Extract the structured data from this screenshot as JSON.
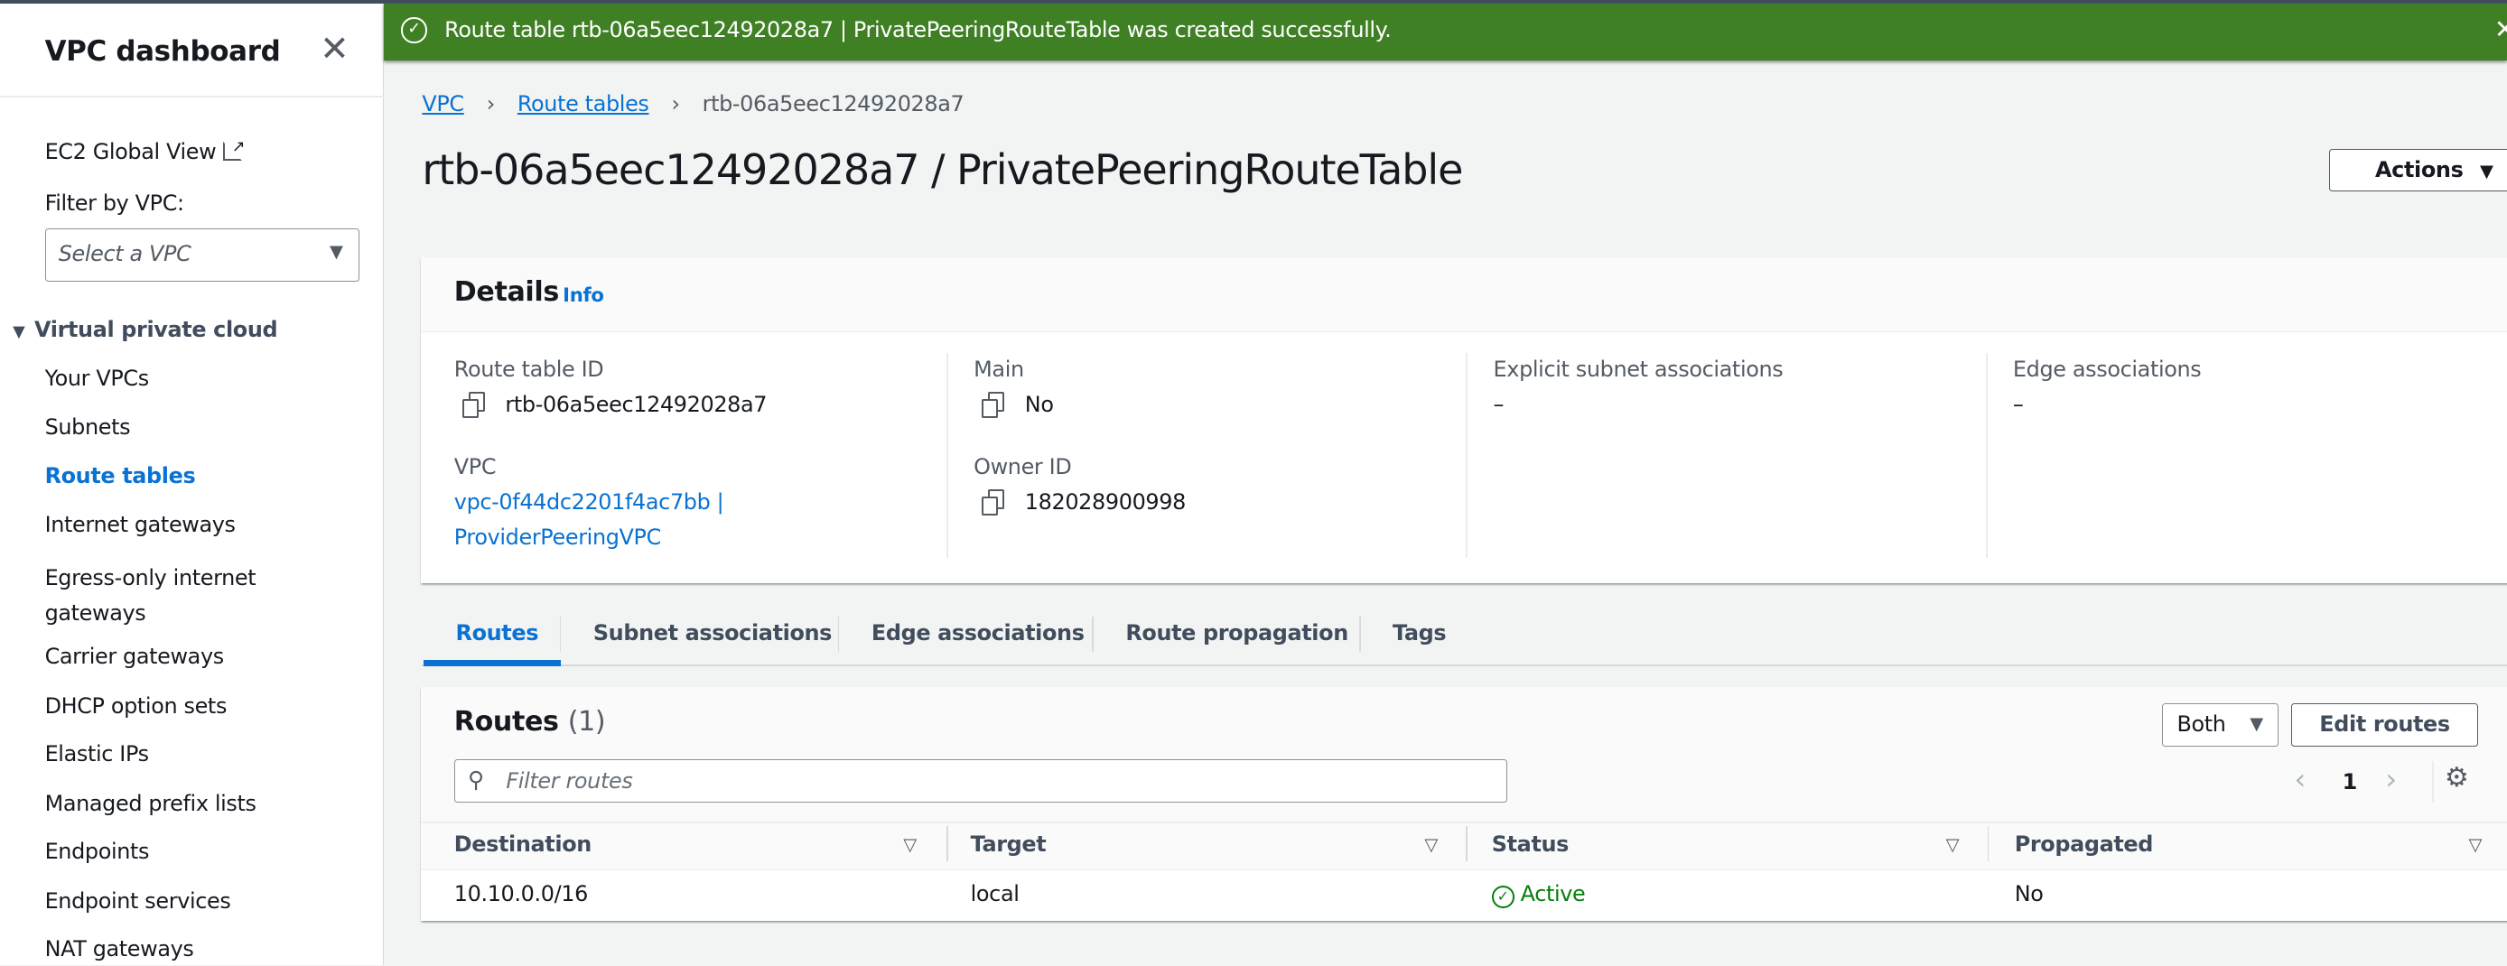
{
  "sidebar": {
    "title": "VPC dashboard",
    "global_view": "EC2 Global View",
    "filter_label": "Filter by VPC:",
    "filter_placeholder": "Select a VPC",
    "section": "Virtual private cloud",
    "items": [
      {
        "label": "Your VPCs"
      },
      {
        "label": "Subnets"
      },
      {
        "label": "Route tables",
        "active": true
      },
      {
        "label": "Internet gateways"
      },
      {
        "label": "Egress-only internet gateways"
      },
      {
        "label": "Carrier gateways"
      },
      {
        "label": "DHCP option sets"
      },
      {
        "label": "Elastic IPs"
      },
      {
        "label": "Managed prefix lists"
      },
      {
        "label": "Endpoints"
      },
      {
        "label": "Endpoint services"
      },
      {
        "label": "NAT gateways"
      }
    ]
  },
  "flash": {
    "message": "Route table rtb-06a5eec12492028a7 | PrivatePeeringRouteTable was created successfully.",
    "color": "#3f8024"
  },
  "breadcrumb": [
    "VPC",
    "Route tables",
    "rtb-06a5eec12492028a7"
  ],
  "page_title": "rtb-06a5eec12492028a7 / PrivatePeeringRouteTable",
  "actions_label": "Actions",
  "details": {
    "title": "Details",
    "info": "Info",
    "route_table_id": {
      "label": "Route table ID",
      "value": "rtb-06a5eec12492028a7"
    },
    "main": {
      "label": "Main",
      "value": "No"
    },
    "explicit": {
      "label": "Explicit subnet associations",
      "value": "–"
    },
    "edge": {
      "label": "Edge associations",
      "value": "–"
    },
    "vpc": {
      "label": "VPC",
      "value_line1": "vpc-0f44dc2201f4ac7bb |",
      "value_line2": "ProviderPeeringVPC"
    },
    "owner": {
      "label": "Owner ID",
      "value": "182028900998"
    }
  },
  "tabs": [
    "Routes",
    "Subnet associations",
    "Edge associations",
    "Route propagation",
    "Tags"
  ],
  "routes": {
    "title": "Routes",
    "count": "(1)",
    "filter_select": "Both",
    "edit_label": "Edit routes",
    "filter_placeholder": "Filter routes",
    "page": "1",
    "columns": [
      "Destination",
      "Target",
      "Status",
      "Propagated"
    ],
    "rows": [
      {
        "destination": "10.10.0.0/16",
        "target": "local",
        "status": "Active",
        "propagated": "No"
      }
    ],
    "active_color": "#037f0c"
  }
}
